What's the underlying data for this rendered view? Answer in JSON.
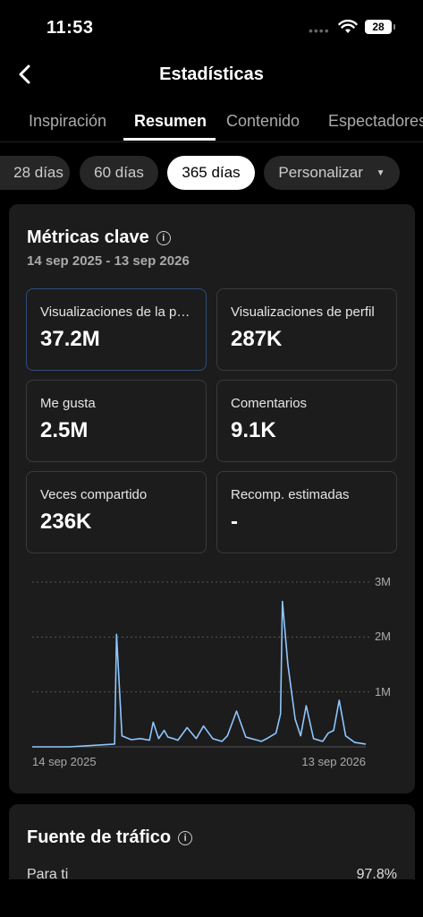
{
  "status_bar": {
    "time": "11:53",
    "battery": "28"
  },
  "header": {
    "title": "Estadísticas"
  },
  "tabs": [
    {
      "label": "Inspiración"
    },
    {
      "label": "Resumen",
      "active": true
    },
    {
      "label": "Contenido"
    },
    {
      "label": "Espectadores"
    }
  ],
  "filters": [
    {
      "label": "28 días"
    },
    {
      "label": "60 días"
    },
    {
      "label": "365 días",
      "active": true
    },
    {
      "label": "Personalizar"
    }
  ],
  "key_metrics": {
    "title": "Métricas clave",
    "date_range": "14 sep 2025 - 13 sep 2026",
    "tiles": [
      {
        "label": "Visualizaciones de la publicación",
        "value": "37.2M",
        "selected": true
      },
      {
        "label": "Visualizaciones de perfil",
        "value": "287K"
      },
      {
        "label": "Me gusta",
        "value": "2.5M"
      },
      {
        "label": "Comentarios",
        "value": "9.1K"
      },
      {
        "label": "Veces compartido",
        "value": "236K"
      },
      {
        "label": "Recomp. estimadas",
        "value": "-"
      }
    ]
  },
  "chart_data": {
    "type": "line",
    "color": "#8fc6ff",
    "ylim": [
      0,
      3000000
    ],
    "y_ticks": [
      "3M",
      "2M",
      "1M"
    ],
    "x_labels": [
      "14 sep 2025",
      "13 sep 2026"
    ],
    "x": [
      "2025-09-14",
      "2025-10-24",
      "2025-12-13",
      "2025-12-15",
      "2025-12-21",
      "2025-12-31",
      "2026-01-10",
      "2026-01-20",
      "2026-01-24",
      "2026-01-30",
      "2026-02-05",
      "2026-02-09",
      "2026-02-15",
      "2026-02-20",
      "2026-03-02",
      "2026-03-12",
      "2026-03-20",
      "2026-03-30",
      "2026-04-09",
      "2026-04-15",
      "2026-04-25",
      "2026-05-05",
      "2026-05-11",
      "2026-05-18",
      "2026-05-22",
      "2026-05-28",
      "2026-06-07",
      "2026-06-12",
      "2026-06-14",
      "2026-06-20",
      "2026-06-28",
      "2026-07-04",
      "2026-07-10",
      "2026-07-18",
      "2026-07-28",
      "2026-08-03",
      "2026-08-09",
      "2026-08-15",
      "2026-08-22",
      "2026-09-01",
      "2026-09-13"
    ],
    "y": [
      0,
      0,
      50000,
      2050000,
      200000,
      130000,
      150000,
      120000,
      450000,
      150000,
      300000,
      180000,
      150000,
      120000,
      350000,
      150000,
      380000,
      150000,
      100000,
      200000,
      650000,
      180000,
      150000,
      120000,
      100000,
      150000,
      250000,
      600000,
      2650000,
      1500000,
      500000,
      200000,
      750000,
      150000,
      100000,
      250000,
      300000,
      850000,
      200000,
      80000,
      50000
    ]
  },
  "traffic_source": {
    "title": "Fuente de tráfico",
    "rows": [
      {
        "label": "Para ti",
        "value": "97.8%"
      }
    ]
  }
}
